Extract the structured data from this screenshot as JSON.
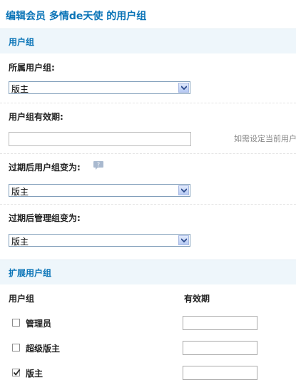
{
  "page_title": "编辑会员  多情de天使  的用户组",
  "section_usergroup": {
    "header": "用户组",
    "current_group_label": "所属用户组:",
    "current_group_value": "版主",
    "expiry_label": "用户组有效期:",
    "expiry_value": "",
    "expiry_hint": "如需设定当前用户",
    "after_expiry_group_label": "过期后用户组变为:",
    "after_expiry_group_value": "版主",
    "after_expiry_admin_label": "过期后管理组变为:",
    "after_expiry_admin_value": "版主"
  },
  "section_extended": {
    "header": "扩展用户组",
    "col_group": "用户组",
    "col_expiry": "有效期",
    "rows": [
      {
        "label": "管理员",
        "checked": false,
        "expiry": ""
      },
      {
        "label": "超级版主",
        "checked": false,
        "expiry": ""
      },
      {
        "label": "版主",
        "checked": true,
        "expiry": ""
      }
    ]
  },
  "colors": {
    "accent": "#0a74b7",
    "section_bg": "#eef6fb"
  },
  "icons": {
    "help": "speech-bubble-icon",
    "dropdown": "chevron-down-icon"
  }
}
